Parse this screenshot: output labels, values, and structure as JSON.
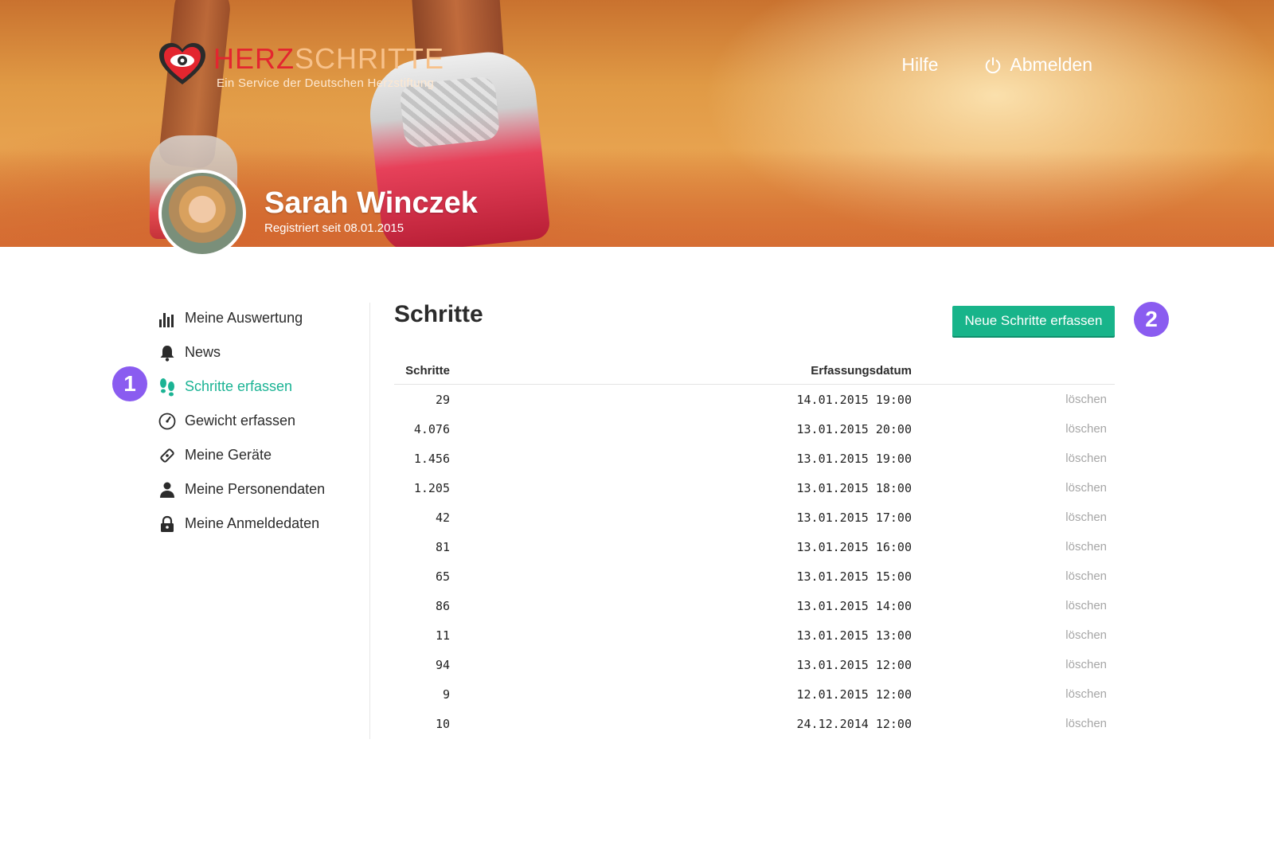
{
  "brand": {
    "name_part1": "HERZ",
    "name_part2": "SCHRITTE",
    "tagline": "Ein Service der Deutschen Herzstiftung",
    "colors": {
      "red": "#e3262f",
      "accent": "#1bb394",
      "badge": "#8a5cf0"
    }
  },
  "topnav": {
    "help_label": "Hilfe",
    "logout_label": "Abmelden"
  },
  "profile": {
    "name": "Sarah Winczek",
    "registered": "Registriert seit 08.01.2015"
  },
  "sidebar": {
    "items": [
      {
        "label": "Meine Auswertung",
        "icon": "bar-chart-icon"
      },
      {
        "label": "News",
        "icon": "bell-icon"
      },
      {
        "label": "Schritte erfassen",
        "icon": "footprints-icon",
        "active": true
      },
      {
        "label": "Gewicht erfassen",
        "icon": "gauge-icon"
      },
      {
        "label": "Meine Geräte",
        "icon": "device-icon"
      },
      {
        "label": "Meine Personendaten",
        "icon": "person-icon"
      },
      {
        "label": "Meine Anmeldedaten",
        "icon": "lock-icon"
      }
    ]
  },
  "badges": {
    "one": "1",
    "two": "2"
  },
  "main": {
    "title": "Schritte",
    "new_button_label": "Neue Schritte erfassen",
    "columns": {
      "steps": "Schritte",
      "date": "Erfassungsdatum"
    },
    "delete_label": "löschen",
    "rows": [
      {
        "steps": "29",
        "date": "14.01.2015 19:00"
      },
      {
        "steps": "4.076",
        "date": "13.01.2015 20:00"
      },
      {
        "steps": "1.456",
        "date": "13.01.2015 19:00"
      },
      {
        "steps": "1.205",
        "date": "13.01.2015 18:00"
      },
      {
        "steps": "42",
        "date": "13.01.2015 17:00"
      },
      {
        "steps": "81",
        "date": "13.01.2015 16:00"
      },
      {
        "steps": "65",
        "date": "13.01.2015 15:00"
      },
      {
        "steps": "86",
        "date": "13.01.2015 14:00"
      },
      {
        "steps": "11",
        "date": "13.01.2015 13:00"
      },
      {
        "steps": "94",
        "date": "13.01.2015 12:00"
      },
      {
        "steps": "9",
        "date": "12.01.2015 12:00"
      },
      {
        "steps": "10",
        "date": "24.12.2014 12:00"
      }
    ]
  }
}
